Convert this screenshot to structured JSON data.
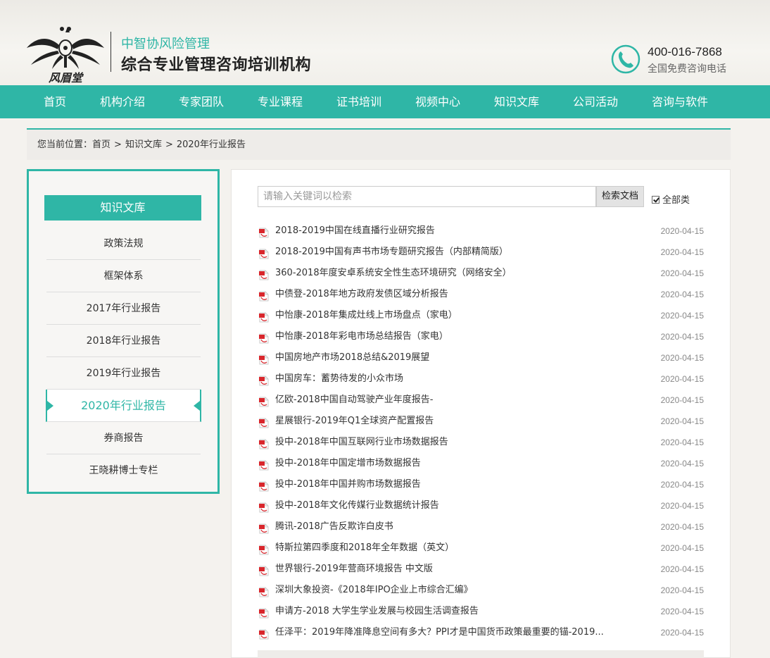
{
  "header": {
    "brand_sub": "中智协风险管理",
    "brand_main": "综合专业管理咨询培训机构",
    "phone_number": "400-016-7868",
    "phone_note": "全国免费咨询电话",
    "logo_text": "风眉堂"
  },
  "nav": {
    "items": [
      "首页",
      "机构介绍",
      "专家团队",
      "专业课程",
      "证书培训",
      "视频中心",
      "知识文库",
      "公司活动",
      "咨询与软件"
    ]
  },
  "breadcrumb": {
    "prefix": "您当前位置：",
    "items": [
      "首页",
      "知识文库",
      "2020年行业报告"
    ],
    "separator": ">"
  },
  "sidebar": {
    "title": "知识文库",
    "items": [
      "政策法规",
      "框架体系",
      "2017年行业报告",
      "2018年行业报告",
      "2019年行业报告",
      "2020年行业报告",
      "券商报告",
      "王晓耕博士专栏"
    ],
    "active_index": 5
  },
  "search": {
    "placeholder": "请输入关键词以检索",
    "button_label": "检索文档",
    "checkbox_label": "全部类",
    "checkbox_checked": true
  },
  "documents": [
    {
      "title": "2018-2019中国在线直播行业研究报告",
      "date": "2020-04-15"
    },
    {
      "title": "2018-2019中国有声书市场专题研究报告（内部精简版）",
      "date": "2020-04-15"
    },
    {
      "title": "360-2018年度安卓系统安全性生态环境研究（网络安全）",
      "date": "2020-04-15"
    },
    {
      "title": "中债登-2018年地方政府发债区域分析报告",
      "date": "2020-04-15"
    },
    {
      "title": "中怡康-2018年集成灶线上市场盘点（家电）",
      "date": "2020-04-15"
    },
    {
      "title": "中怡康-2018年彩电市场总结报告（家电）",
      "date": "2020-04-15"
    },
    {
      "title": "中国房地产市场2018总结&2019展望",
      "date": "2020-04-15"
    },
    {
      "title": "中国房车：蓄势待发的小众市场",
      "date": "2020-04-15"
    },
    {
      "title": "亿欧-2018中国自动驾驶产业年度报告-",
      "date": "2020-04-15"
    },
    {
      "title": "星展银行-2019年Q1全球资产配置报告",
      "date": "2020-04-15"
    },
    {
      "title": "投中-2018年中国互联网行业市场数据报告",
      "date": "2020-04-15"
    },
    {
      "title": "投中-2018年中国定增市场数据报告",
      "date": "2020-04-15"
    },
    {
      "title": "投中-2018年中国并购市场数据报告",
      "date": "2020-04-15"
    },
    {
      "title": "投中-2018年文化传媒行业数据统计报告",
      "date": "2020-04-15"
    },
    {
      "title": "腾讯-2018广告反欺诈白皮书",
      "date": "2020-04-15"
    },
    {
      "title": "特斯拉第四季度和2018年全年数据（英文）",
      "date": "2020-04-15"
    },
    {
      "title": "世界银行-2019年营商环境报告 中文版",
      "date": "2020-04-15"
    },
    {
      "title": "深圳大象投资-《2018年IPO企业上市综合汇编》",
      "date": "2020-04-15"
    },
    {
      "title": "申请方-2018 大学生学业发展与校园生活调查报告",
      "date": "2020-04-15"
    },
    {
      "title": "任泽平：2019年降准降息空间有多大？PPI才是中国货币政策最重要的锚-2019...",
      "date": "2020-04-15"
    }
  ],
  "colors": {
    "accent": "#2fb6a6",
    "pdf_red": "#d9262c"
  }
}
